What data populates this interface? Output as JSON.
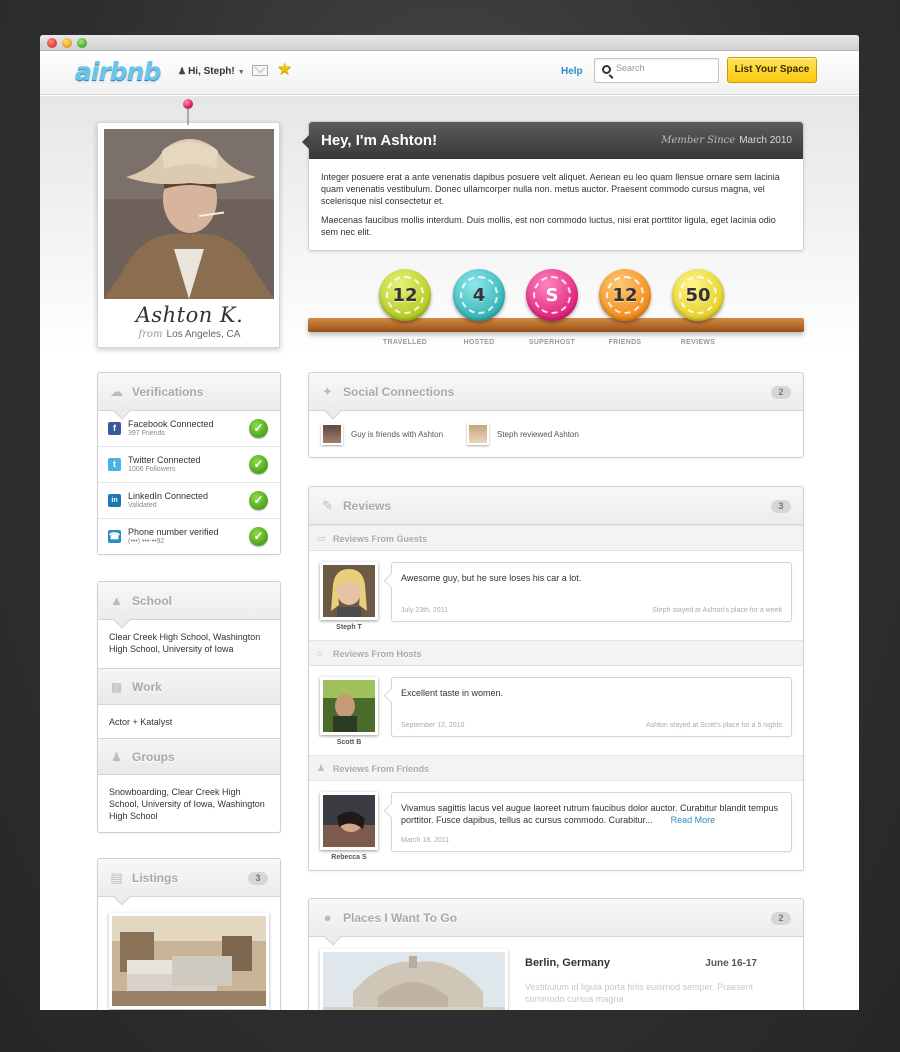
{
  "nav": {
    "logo": "airbnb",
    "user_greeting": "Hi, Steph!",
    "help": "Help",
    "search_placeholder": "Search",
    "list_space": "List Your Space"
  },
  "profile": {
    "name": "Ashton K.",
    "from_label": "from",
    "location": "Los Angeles, CA"
  },
  "intro": {
    "title": "Hey, I'm Ashton!",
    "member_since_label": "Member Since",
    "member_since": "March 2010",
    "para1": "Integer posuere erat a ante venenatis dapibus posuere velt aliquet. Aenean eu leo quam llensue ornare sem lacinia quam venenatis vestibulum. Donec ullamcorper nulla non. metus auctor. Praesent commodo cursus magna, vel scelerisque nisl consectetur et.",
    "para2": "Maecenas faucibus mollis interdum. Duis mollis, est non commodo luctus, nisi erat porttitor ligula, eget lacinia odio sem nec elit."
  },
  "badges": [
    {
      "value": "12",
      "label": "TRAVELLED",
      "color": "#c7dc3a"
    },
    {
      "value": "4",
      "label": "HOSTED",
      "color": "#4cc6c8"
    },
    {
      "value": "S",
      "label": "SUPERHOST",
      "color": "#e8338a"
    },
    {
      "value": "12",
      "label": "FRIENDS",
      "color": "#f59a2b"
    },
    {
      "value": "50",
      "label": "REVIEWS",
      "color": "#eedb3a"
    }
  ],
  "verifications": {
    "title": "Verifications",
    "items": [
      {
        "title": "Facebook Connected",
        "sub": "397 Friends",
        "icon": "f",
        "color": "#3b5998"
      },
      {
        "title": "Twitter Connected",
        "sub": "1006 Followers",
        "icon": "t",
        "color": "#4ab3e6"
      },
      {
        "title": "LinkedIn Connected",
        "sub": "Validated",
        "icon": "in",
        "color": "#1b7ab3"
      },
      {
        "title": "Phone number verified",
        "sub": "(•••) •••-••92",
        "icon": "☎",
        "color": "#2a8ec7"
      }
    ]
  },
  "about": {
    "school_title": "School",
    "school": "Clear Creek High School, Washington High School, University of Iowa",
    "work_title": "Work",
    "work": "Actor + Katalyst",
    "groups_title": "Groups",
    "groups": "Snowboarding, Clear Creek High School, University of Iowa, Washington High School"
  },
  "listings": {
    "title": "Listings",
    "count": "3"
  },
  "social": {
    "title": "Social Connections",
    "count": "2",
    "items": [
      "Guy is friends with Ashton",
      "Steph reviewed Ashton"
    ]
  },
  "reviews": {
    "title": "Reviews",
    "count": "3",
    "guests_label": "Reviews From Guests",
    "hosts_label": "Reviews From Hosts",
    "friends_label": "Reviews From Friends",
    "items": [
      {
        "name": "Steph T",
        "text": "Awesome guy, but he sure loses his car a lot.",
        "date": "July 23th, 2011",
        "meta": "Steph stayed at Ashton's place for a week"
      },
      {
        "name": "Scott B",
        "text": "Excellent taste in women.",
        "date": "September 12, 2010",
        "meta": "Ashton stayed at Scott's place for a 5 nights"
      },
      {
        "name": "Rebecca S",
        "text": "Vivamus sagittis lacus vel augue laoreet rutrum faucibus dolor auctor. Curabitur blandit tempus porttitor. Fusce dapibus, tellus ac cursus commodo. Curabitur...",
        "date": "March 18, 2011",
        "meta": "",
        "read_more": "Read More"
      }
    ]
  },
  "places": {
    "title": "Places I Want To Go",
    "count": "2",
    "city": "Berlin, Germany",
    "dates": "June 16-17",
    "desc": "Vestibulum id ligula porta felis euismod semper. Praesent commodo cursus magna"
  }
}
